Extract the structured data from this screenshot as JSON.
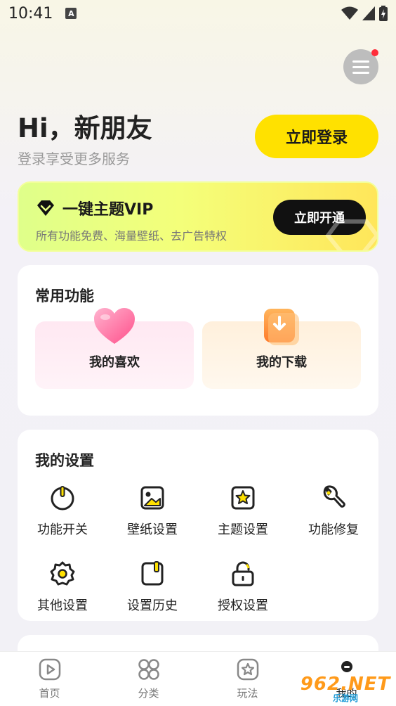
{
  "status": {
    "time": "10:41",
    "notif_badge": "A"
  },
  "header": {
    "greeting": "Hi，新朋友",
    "subtitle": "登录享受更多服务",
    "login_label": "立即登录"
  },
  "vip": {
    "title": "一键主题VIP",
    "description": "所有功能免费、海量壁纸、去广告特权",
    "button_label": "立即开通"
  },
  "common": {
    "title": "常用功能",
    "items": [
      {
        "label": "我的喜欢",
        "icon": "heart-icon"
      },
      {
        "label": "我的下载",
        "icon": "download-icon"
      }
    ]
  },
  "settings": {
    "title": "我的设置",
    "items": [
      {
        "label": "功能开关",
        "icon": "power-icon"
      },
      {
        "label": "壁纸设置",
        "icon": "image-icon"
      },
      {
        "label": "主题设置",
        "icon": "star-frame-icon"
      },
      {
        "label": "功能修复",
        "icon": "wrench-icon"
      },
      {
        "label": "其他设置",
        "icon": "gear-icon"
      },
      {
        "label": "设置历史",
        "icon": "history-icon"
      },
      {
        "label": "授权设置",
        "icon": "lock-icon"
      }
    ]
  },
  "tabs": [
    {
      "label": "首页",
      "icon": "play-icon"
    },
    {
      "label": "分类",
      "icon": "grid-icon"
    },
    {
      "label": "玩法",
      "icon": "star-icon"
    },
    {
      "label": "我的",
      "icon": "profile-icon"
    }
  ],
  "watermark": {
    "main": "962.NET",
    "sub": "乐游网"
  },
  "colors": {
    "accent": "#ffe100",
    "vip_start": "#dfff8a",
    "vip_end": "#ffe65a",
    "badge": "#ff2d3a"
  }
}
